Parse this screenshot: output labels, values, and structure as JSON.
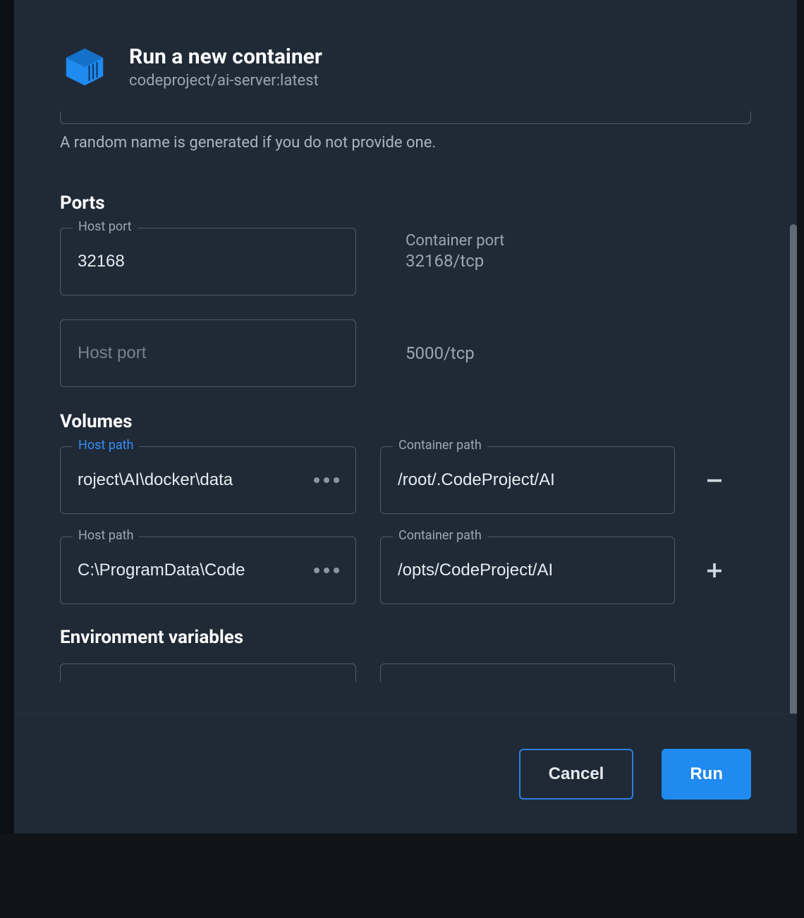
{
  "header": {
    "title": "Run a new container",
    "subtitle": "codeproject/ai-server:latest",
    "icon": "docker-container-icon"
  },
  "name_hint": "A random name is generated if you do not provide one.",
  "sections": {
    "ports": {
      "title": "Ports",
      "rows": [
        {
          "host_label": "Host port",
          "host_value": "32168",
          "host_placeholder": "",
          "container_label": "Container port",
          "container_value": "32168/tcp"
        },
        {
          "host_label": "",
          "host_value": "",
          "host_placeholder": "Host port",
          "container_label": "",
          "container_value": "5000/tcp"
        }
      ]
    },
    "volumes": {
      "title": "Volumes",
      "rows": [
        {
          "host_label": "Host path",
          "host_label_active": true,
          "host_value": "roject\\AI\\docker\\data",
          "container_label": "Container path",
          "container_value": "/root/.CodeProject/AI",
          "action": "remove"
        },
        {
          "host_label": "Host path",
          "host_label_active": false,
          "host_value": "C:\\ProgramData\\Code",
          "container_label": "Container path",
          "container_value": "/opts/CodeProject/AI",
          "action": "add"
        }
      ]
    },
    "env": {
      "title": "Environment variables"
    }
  },
  "buttons": {
    "cancel": "Cancel",
    "run": "Run"
  },
  "colors": {
    "accent": "#1f8aef",
    "bg": "#1f2a36",
    "border": "#4f5b66",
    "text_muted": "#9aa7b3"
  }
}
